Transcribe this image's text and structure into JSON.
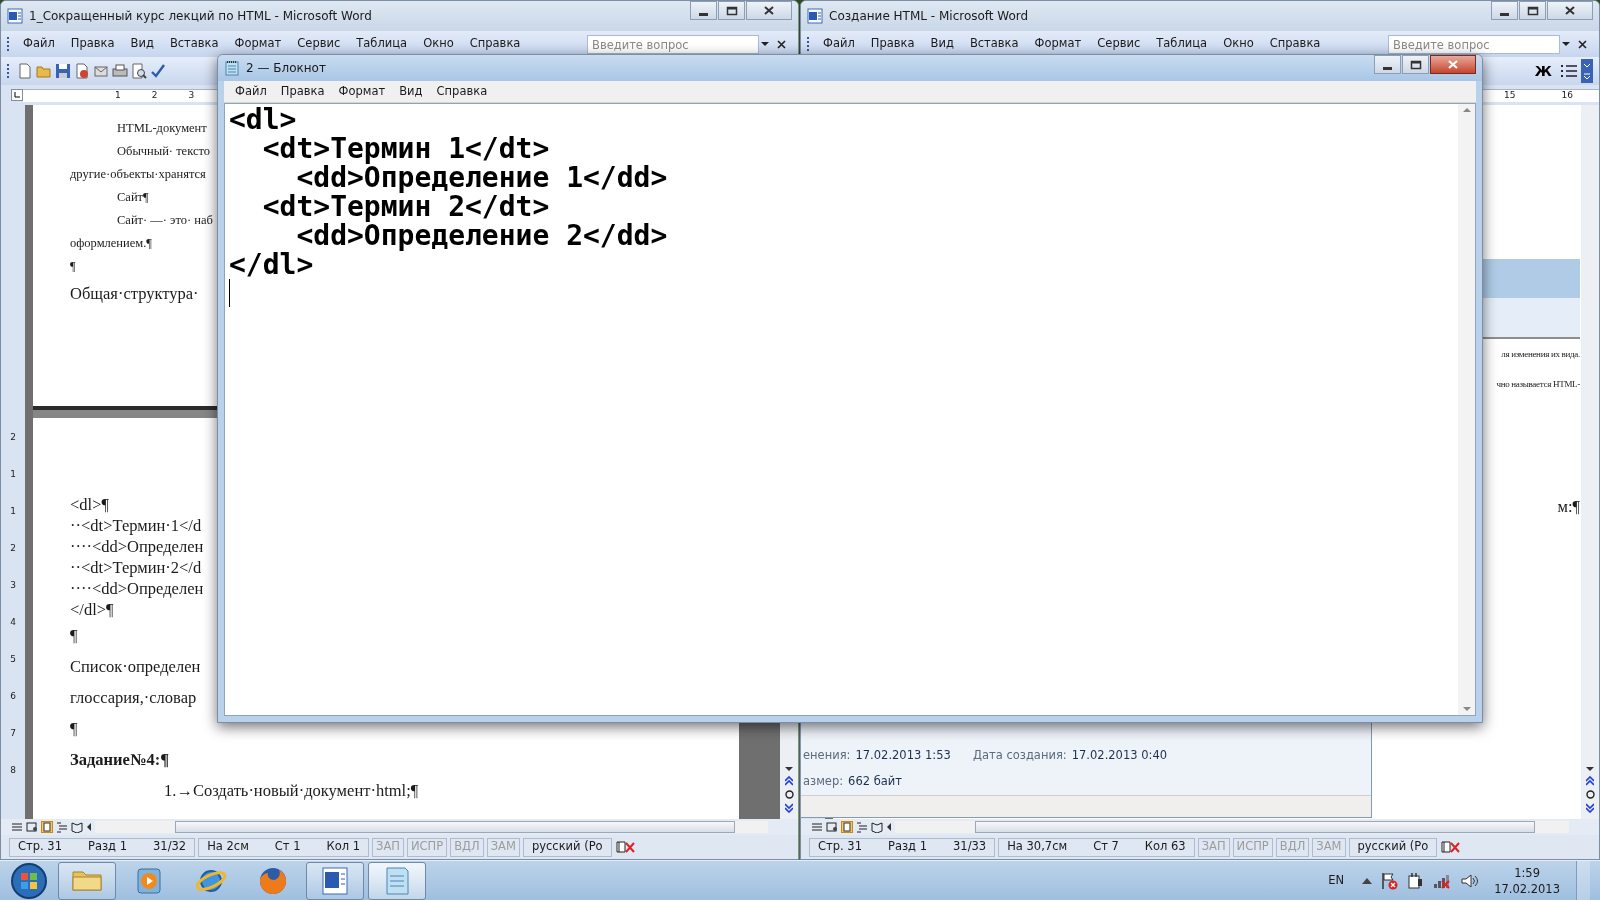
{
  "windows": [
    {
      "kind": "word",
      "title": "1_Сокращенный курс лекций по HTML - Microsoft Word",
      "active": false,
      "menu": [
        "Файл",
        "Правка",
        "Вид",
        "Вставка",
        "Формат",
        "Сервис",
        "Таблица",
        "Окно",
        "Справка"
      ],
      "help_search": {
        "placeholder": "Введите вопрос"
      },
      "ruler": [
        "1",
        "2",
        "3"
      ],
      "vertical_ruler": [
        "2",
        "1",
        "1",
        "2",
        "3",
        "4",
        "5",
        "6",
        "7",
        "8"
      ],
      "document": [
        {
          "kind": "indent",
          "text": "HTML-документ"
        },
        {
          "kind": "indent",
          "text": "Обычный· тексто"
        },
        {
          "kind": "small",
          "text": "другие·объекты·хранятся"
        },
        {
          "kind": "indent",
          "text": "Сайт¶"
        },
        {
          "kind": "indent",
          "text": "Сайт· —· это· наб"
        },
        {
          "kind": "small",
          "text": "оформлением.¶"
        },
        {
          "kind": "small",
          "text": "¶"
        },
        {
          "kind": "large",
          "text": "Общая·структура·"
        },
        {
          "kind": "page_break"
        },
        {
          "kind": "code",
          "text": "<dl>¶"
        },
        {
          "kind": "code",
          "text": "··<dt>Термин·1</d"
        },
        {
          "kind": "code",
          "text": "····<dd>Определен"
        },
        {
          "kind": "code",
          "text": "··<dt>Термин·2</d"
        },
        {
          "kind": "code",
          "text": "····<dd>Определен"
        },
        {
          "kind": "code",
          "text": "</dl>¶"
        },
        {
          "kind": "large",
          "text": "¶"
        },
        {
          "kind": "large",
          "text": "Список·определен"
        },
        {
          "kind": "large",
          "text": "глоссария,·словар"
        },
        {
          "kind": "large",
          "text": "¶"
        },
        {
          "kind": "heading",
          "text": "Задание№4:¶"
        },
        {
          "kind": "list",
          "text": "1.→Создать·новый·документ·html;¶"
        }
      ],
      "status_bar": [
        {
          "kind": "page",
          "text": "Стр. 31",
          "disabled": false
        },
        {
          "kind": "page",
          "text": "Разд 1",
          "disabled": false
        },
        {
          "kind": "page",
          "text": "31/32",
          "disabled": false
        },
        {
          "kind": "position",
          "text": "На 2см",
          "disabled": false
        },
        {
          "kind": "position",
          "text": "Ст 1",
          "disabled": false
        },
        {
          "kind": "position",
          "text": "Кол 1",
          "disabled": false
        },
        {
          "kind": "mode",
          "text": "ЗАП",
          "disabled": true
        },
        {
          "kind": "mode",
          "text": "ИСПР",
          "disabled": true
        },
        {
          "kind": "mode",
          "text": "ВДЛ",
          "disabled": true
        },
        {
          "kind": "mode",
          "text": "ЗАМ",
          "disabled": true
        },
        {
          "kind": "language",
          "text": "русский (Ро",
          "disabled": false
        }
      ]
    },
    {
      "kind": "word",
      "title": "Создание HTML - Microsoft Word",
      "active": false,
      "menu": [
        "Файл",
        "Правка",
        "Вид",
        "Вставка",
        "Формат",
        "Сервис",
        "Таблица",
        "Окно",
        "Справка"
      ],
      "help_search": {
        "placeholder": "Введите вопрос"
      },
      "format_buttons": [
        "Ж"
      ],
      "ruler": [
        "15",
        "16"
      ],
      "document": [
        {
          "kind": "shaded"
        },
        {
          "kind": "fragment",
          "text": "ля изменения их вида."
        },
        {
          "kind": "fragment",
          "text": "чно называется HTML-"
        },
        {
          "kind": "fragment_large",
          "text": "м:¶"
        }
      ],
      "status_bar": [
        {
          "kind": "page",
          "text": "Стр. 31",
          "disabled": false
        },
        {
          "kind": "page",
          "text": "Разд 1",
          "disabled": false
        },
        {
          "kind": "page",
          "text": "31/33",
          "disabled": false
        },
        {
          "kind": "position",
          "text": "На 30,7см",
          "disabled": false
        },
        {
          "kind": "position",
          "text": "Ст 7",
          "disabled": false
        },
        {
          "kind": "position",
          "text": "Кол 63",
          "disabled": false
        },
        {
          "kind": "mode",
          "text": "ЗАП",
          "disabled": true
        },
        {
          "kind": "mode",
          "text": "ИСПР",
          "disabled": true
        },
        {
          "kind": "mode",
          "text": "ВДЛ",
          "disabled": true
        },
        {
          "kind": "mode",
          "text": "ЗАМ",
          "disabled": true
        },
        {
          "kind": "language",
          "text": "русский (Ро",
          "disabled": false
        }
      ]
    }
  ],
  "file_details": [
    {
      "label": "енения:",
      "value": "17.02.2013 1:53"
    },
    {
      "label": "Дата создания:",
      "value": "17.02.2013 0:40"
    },
    {
      "label": "азмер:",
      "value": "662 байт"
    }
  ],
  "notepad": {
    "title": "2 — Блокнот",
    "active": true,
    "menu": [
      "Файл",
      "Правка",
      "Формат",
      "Вид",
      "Справка"
    ],
    "content": [
      "<dl>",
      "  <dt>Термин 1</dt>",
      "    <dd>Определение 1</dd>",
      "  <dt>Термин 2</dt>",
      "    <dd>Определение 2</dd>",
      "</dl>"
    ]
  },
  "taskbar": {
    "apps": [
      {
        "kind": "explorer",
        "open": true,
        "selected": false
      },
      {
        "kind": "media",
        "open": false,
        "selected": false
      },
      {
        "kind": "ie",
        "open": false,
        "selected": false
      },
      {
        "kind": "firefox",
        "open": false,
        "selected": false
      },
      {
        "kind": "word",
        "open": true,
        "selected": false
      },
      {
        "kind": "notepad",
        "open": true,
        "selected": true
      }
    ],
    "language": "EN",
    "time": "1:59",
    "date": "17.02.2013"
  }
}
